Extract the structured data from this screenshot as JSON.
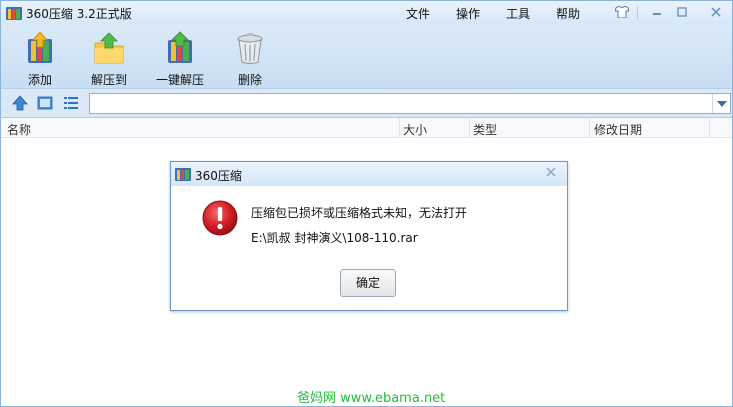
{
  "window": {
    "title": "360压缩 3.2正式版",
    "menus": [
      "文件",
      "操作",
      "工具",
      "帮助"
    ]
  },
  "toolbar": {
    "buttons": [
      {
        "label": "添加",
        "icon": "add-archive-icon"
      },
      {
        "label": "解压到",
        "icon": "extract-to-folder-icon"
      },
      {
        "label": "一键解压",
        "icon": "one-click-extract-icon"
      },
      {
        "label": "删除",
        "icon": "trash-bin-icon"
      }
    ]
  },
  "addressbar": {
    "value": "",
    "nav_icons": [
      "up-arrow-icon",
      "view-thumbnail-icon",
      "view-list-icon"
    ]
  },
  "list": {
    "columns": [
      "名称",
      "大小",
      "类型",
      "修改日期"
    ]
  },
  "dialog": {
    "title": "360压缩",
    "message": "压缩包已损坏或压缩格式未知，无法打开",
    "path": "E:\\凯叔 封神演义\\108-110.rar",
    "ok_label": "确定"
  },
  "watermark": "爸妈网 www.ebama.net",
  "colors": {
    "accent": "#2a78c8",
    "error": "#d21f26",
    "watermark": "#1fbf3b"
  }
}
